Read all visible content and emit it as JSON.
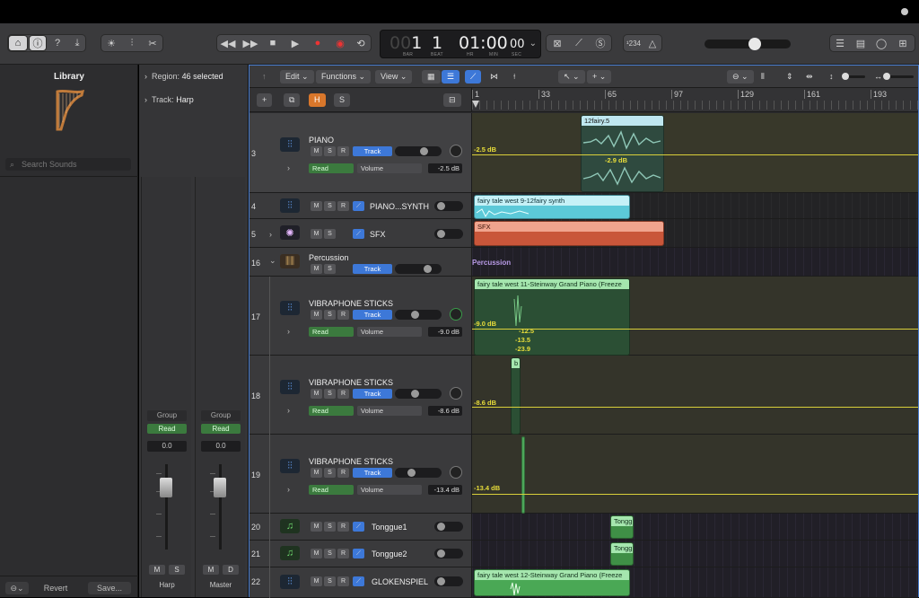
{
  "toolbar": {
    "lcd": {
      "bar_dim": "00",
      "bar": "1",
      "beat": "1",
      "time_main": "01:00",
      "time_sub": "00",
      "lbl_bar": "BAR",
      "lbl_beat": "BEAT",
      "lbl_hr": "HR",
      "lbl_min": "MIN",
      "lbl_sec": "SEC"
    },
    "count_in": "¹234",
    "master_volume_fraction": 0.6
  },
  "library": {
    "title": "Library",
    "search_placeholder": "Search Sounds",
    "revert": "Revert",
    "save": "Save..."
  },
  "inspector": {
    "region_label": "Region:",
    "region_value": "46 selected",
    "track_label": "Track:",
    "track_value": "Harp",
    "strips": [
      {
        "group": "Group",
        "read": "Read",
        "value": "0.0",
        "m": "M",
        "s": "S",
        "name": "Harp"
      },
      {
        "group": "Group",
        "read": "Read",
        "value": "0.0",
        "m": "M",
        "s": "D",
        "name": "Master"
      }
    ]
  },
  "arrange": {
    "menus": {
      "edit": "Edit",
      "functions": "Functions",
      "view": "View"
    },
    "header_buttons": {
      "add": "+",
      "h": "H",
      "s": "S"
    },
    "ruler": [
      "1",
      "33",
      "65",
      "97",
      "129",
      "161",
      "193"
    ],
    "tracks": [
      {
        "num": "3",
        "name": "PIANO",
        "track": "Track",
        "read": "Read",
        "param": "Volume",
        "db": "-2.5 dB"
      },
      {
        "num": "4",
        "name": "PIANO...SYNTH"
      },
      {
        "num": "5",
        "name": "SFX"
      },
      {
        "num": "16",
        "name": "Percussion",
        "track": "Track"
      },
      {
        "num": "17",
        "name": "VIBRAPHONE STICKS",
        "track": "Track",
        "read": "Read",
        "param": "Volume",
        "db": "-9.0 dB"
      },
      {
        "num": "18",
        "name": "VIBRAPHONE STICKS",
        "track": "Track",
        "read": "Read",
        "param": "Volume",
        "db": "-8.6 dB"
      },
      {
        "num": "19",
        "name": "VIBRAPHONE STICKS",
        "track": "Track",
        "read": "Read",
        "param": "Volume",
        "db": "-13.4 dB"
      },
      {
        "num": "20",
        "name": "Tonggue1"
      },
      {
        "num": "21",
        "name": "Tonggue2"
      },
      {
        "num": "22",
        "name": "GLOKENSPIEL"
      }
    ],
    "msr": {
      "m": "M",
      "s": "S",
      "r": "R"
    },
    "regions": {
      "piano": "12fairy.5",
      "synth": "fairy tale west 9-12fairy synth",
      "sfx": "SFX",
      "percussion": "Percussion",
      "vib17": "fairy tale west 11-Steinway Grand Piano (Freeze",
      "vib18": "b",
      "tong1": "Tongg",
      "tong2": "Tongg",
      "glok": "fairy tale west 12-Steinway Grand Piano (Freeze"
    },
    "automation": {
      "piano_left": "-2.5 dB",
      "piano_mid": "-2.9 dB",
      "vib17_left": "-9.0 dB",
      "vib17_a": "-12.5",
      "vib17_b": "-13.5",
      "vib17_c": "-23.9",
      "vib18_left": "-8.6 dB",
      "vib19_left": "-13.4 dB"
    }
  }
}
